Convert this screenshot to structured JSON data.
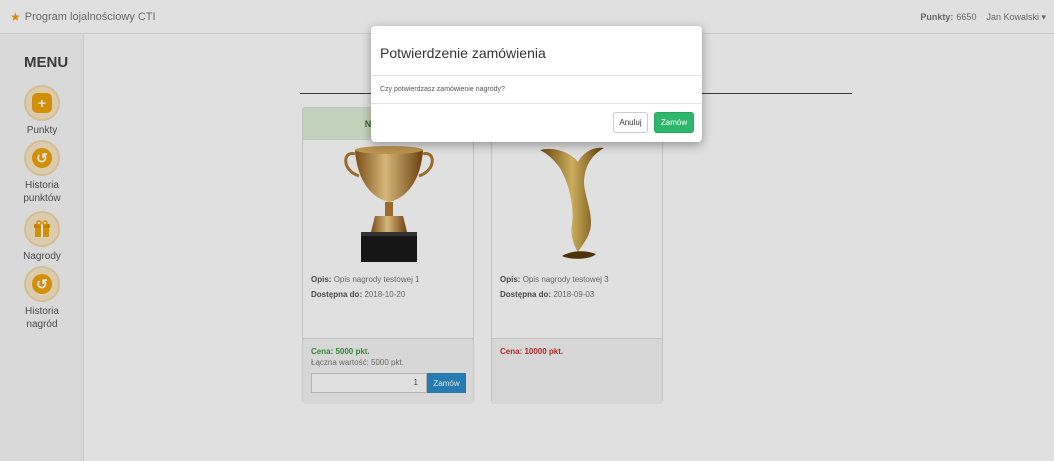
{
  "navbar": {
    "brand": "Program lojalnościowy CTI",
    "points_label": "Punkty:",
    "points_value": "6650",
    "user": "Jan Kowalski ▾"
  },
  "sidebar": {
    "title": "MENU",
    "items": [
      {
        "label": "Punkty",
        "icon": "plus-icon"
      },
      {
        "label": "Historia punktów",
        "icon": "history-icon"
      },
      {
        "label": "Nagrody",
        "icon": "gift-icon"
      },
      {
        "label": "Historia nagród",
        "icon": "history-icon"
      }
    ]
  },
  "cards": [
    {
      "header": "NAGRODA",
      "desc_label": "Opis:",
      "desc": "Opis nagrody testowej 1",
      "available_label": "Dostępna do:",
      "available": "2018-10-20",
      "price": "Cena: 5000 pkt.",
      "total": "Łączna wartość: 5000 pkt.",
      "qty": "1",
      "order_label": "Zamów"
    },
    {
      "desc_label": "Opis:",
      "desc": "Opis nagrody testowej 3",
      "available_label": "Dostępna do:",
      "available": "2018-09-03",
      "price": "Cena: 10000 pkt."
    }
  ],
  "modal": {
    "title": "Potwierdzenie zamówienia",
    "body": "Czy potwierdzasz zamówienie nagrody?",
    "cancel_label": "Anuluj",
    "confirm_label": "Zamów"
  },
  "colors": {
    "accent": "#f0a30a",
    "confirm": "#2eb66c",
    "order": "#2e8dc9",
    "price_ok": "#3c9a3c",
    "price_bad": "#c9302c"
  }
}
